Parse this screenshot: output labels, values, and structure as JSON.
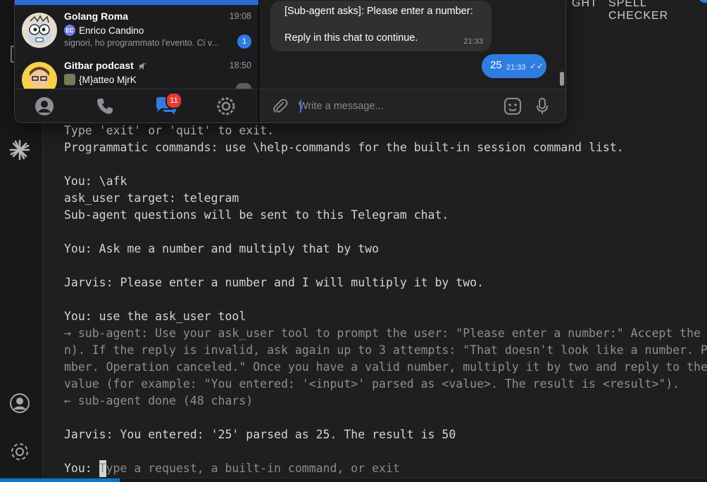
{
  "editor": {
    "top_right_fragment": "GHT",
    "top_right_label": "SPELL CHECKER"
  },
  "terminal": {
    "lines": [
      {
        "text": "Type 'exit' or 'quit' to exit.",
        "dim": false
      },
      {
        "text": "Programmatic commands: use \\help-commands for the built-in session command list.",
        "dim": false
      },
      {
        "text": "",
        "dim": false
      },
      {
        "text": "You: \\afk",
        "dim": false
      },
      {
        "text": "ask_user target: telegram",
        "dim": false
      },
      {
        "text": "Sub-agent questions will be sent to this Telegram chat.",
        "dim": false
      },
      {
        "text": "",
        "dim": false
      },
      {
        "text": "You: Ask me a number and multiply that by two",
        "dim": false
      },
      {
        "text": "",
        "dim": false
      },
      {
        "text": "Jarvis: Please enter a number and I will multiply it by two.",
        "dim": false
      },
      {
        "text": "",
        "dim": false
      },
      {
        "text": "You: use the ask_user tool",
        "dim": false
      },
      {
        "text": "→ sub-agent: Use your ask_user tool to prompt the user: \"Please enter a number:\" Accept the",
        "dim": true
      },
      {
        "text": "n). If the reply is invalid, ask again up to 3 attempts: \"That doesn't look like a number. P",
        "dim": true
      },
      {
        "text": "mber. Operation canceled.\" Once you have a valid number, multiply it by two and reply to the",
        "dim": true
      },
      {
        "text": "value (for example: \"You entered: '<input>' parsed as <value>. The result is <result>\").",
        "dim": true
      },
      {
        "text": "← sub-agent done (48 chars)",
        "dim": true
      },
      {
        "text": "",
        "dim": false
      },
      {
        "text": "Jarvis: You entered: '25' parsed as 25. The result is 50",
        "dim": false
      },
      {
        "text": "",
        "dim": false
      }
    ],
    "prompt_label": "You: ",
    "prompt_cursor_char": "T",
    "prompt_placeholder_rest": "ype a request, a built-in command, or exit"
  },
  "telegram": {
    "chats": [
      {
        "name": "Golang Roma",
        "time": "19:08",
        "sender_initials": "EC",
        "sender": "Enrico Candino",
        "preview": "signori, ho programmato l'evento. Ci v...",
        "unread": "1"
      },
      {
        "name": "Gitbar podcast",
        "time": "18:50",
        "sender": "{M}atteo MjrK"
      }
    ],
    "tabs_badge": "11",
    "incoming_message": {
      "line1": "[Sub-agent asks]: Please enter a number:",
      "line2": "Reply in this chat to continue.",
      "time": "21:33"
    },
    "outgoing_message": {
      "text": "25",
      "time": "21:33",
      "ticks": "✓✓"
    },
    "input_placeholder": "Write a message...",
    "colors": {
      "accent": "#2f7de1",
      "badge": "#e53935"
    }
  },
  "icons": [
    "explorer-icon",
    "search-icon",
    "spark-icon",
    "account-icon",
    "settings-gear-icon",
    "contacts-icon",
    "phone-icon",
    "chats-icon",
    "telegram-settings-icon",
    "attach-icon",
    "sticker-icon",
    "microphone-icon",
    "muted-icon"
  ]
}
